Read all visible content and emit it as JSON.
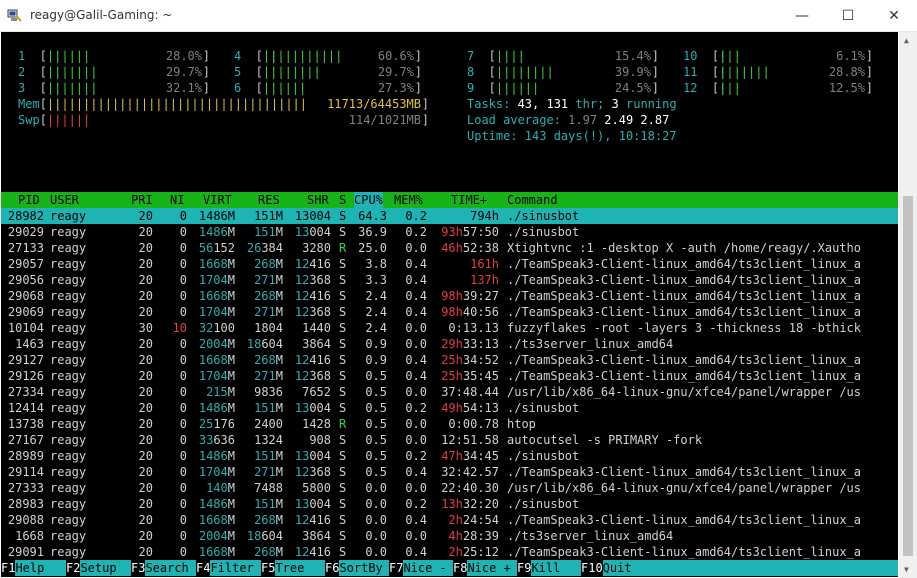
{
  "window": {
    "title": "reagy@Galil-Gaming: ~"
  },
  "meters": {
    "cpus": [
      {
        "label": "1",
        "bar": "||||||",
        "pct": "28.0%"
      },
      {
        "label": "2",
        "bar": "|||||||",
        "pct": "29.7%"
      },
      {
        "label": "3",
        "bar": "|||||||",
        "pct": "32.1%"
      },
      {
        "label": "4",
        "bar": "|||||||||||",
        "pct": "60.6%"
      },
      {
        "label": "5",
        "bar": "||||||||",
        "pct": "29.7%"
      },
      {
        "label": "6",
        "bar": "||||||",
        "pct": "27.3%"
      },
      {
        "label": "7",
        "bar": "||||",
        "pct": "15.4%"
      },
      {
        "label": "8",
        "bar": "||||||||",
        "pct": "39.9%"
      },
      {
        "label": "9",
        "bar": "||||||",
        "pct": "24.5%"
      },
      {
        "label": "10",
        "bar": "|||",
        "pct": "6.1%"
      },
      {
        "label": "11",
        "bar": "|||||||",
        "pct": "28.8%"
      },
      {
        "label": "12",
        "bar": "|||",
        "pct": "12.5%"
      }
    ],
    "mem": {
      "label": "Mem",
      "bar": "||||||||||||||||||||||||||||||||||||",
      "value": "11713/64453MB"
    },
    "swp": {
      "label": "Swp",
      "bar": "||||||",
      "value": "114/1021MB"
    },
    "tasks": {
      "label": "Tasks:",
      "count": "43,",
      "thr": "131",
      "thr_label": "thr;",
      "running": "3",
      "running_label": "running"
    },
    "load": {
      "label": "Load average:",
      "v1": "1.97",
      "v2": "2.49",
      "v3": "2.87"
    },
    "uptime": {
      "label": "Uptime:",
      "value": "143 days(!), 10:18:27"
    }
  },
  "table": {
    "headers": [
      "PID",
      "USER",
      "PRI",
      "NI",
      "VIRT",
      "RES",
      "SHR",
      "S",
      "CPU%",
      "MEM%",
      "TIME+",
      "Command"
    ],
    "rows": [
      {
        "pid": "28982",
        "user": "reagy",
        "pri": "20",
        "ni": "0",
        "virt": "1486M",
        "res": "151M",
        "shr": "13004",
        "s": "S",
        "cpu": "64.3",
        "mem": "0.2",
        "time": "794h",
        "cmd": "./sinusbot"
      },
      {
        "pid": "29029",
        "user": "reagy",
        "pri": "20",
        "ni": "0",
        "virt": "1486M",
        "res": "151M",
        "shr": "13004",
        "s": "S",
        "cpu": "36.9",
        "mem": "0.2",
        "time": "93h57:50",
        "cmd": "./sinusbot"
      },
      {
        "pid": "27133",
        "user": "reagy",
        "pri": "20",
        "ni": "0",
        "virt": "56152",
        "res": "26384",
        "shr": "3280",
        "s": "R",
        "cpu": "25.0",
        "mem": "0.0",
        "time": "46h52:38",
        "cmd": "Xtightvnc :1 -desktop X -auth /home/reagy/.Xautho"
      },
      {
        "pid": "29057",
        "user": "reagy",
        "pri": "20",
        "ni": "0",
        "virt": "1668M",
        "res": "268M",
        "shr": "12416",
        "s": "S",
        "cpu": "3.8",
        "mem": "0.4",
        "time": "161h",
        "cmd": "./TeamSpeak3-Client-linux_amd64/ts3client_linux_a"
      },
      {
        "pid": "29056",
        "user": "reagy",
        "pri": "20",
        "ni": "0",
        "virt": "1704M",
        "res": "271M",
        "shr": "12368",
        "s": "S",
        "cpu": "3.3",
        "mem": "0.4",
        "time": "137h",
        "cmd": "./TeamSpeak3-Client-linux_amd64/ts3client_linux_a"
      },
      {
        "pid": "29068",
        "user": "reagy",
        "pri": "20",
        "ni": "0",
        "virt": "1668M",
        "res": "268M",
        "shr": "12416",
        "s": "S",
        "cpu": "2.4",
        "mem": "0.4",
        "time": "98h39:27",
        "cmd": "./TeamSpeak3-Client-linux_amd64/ts3client_linux_a"
      },
      {
        "pid": "29069",
        "user": "reagy",
        "pri": "20",
        "ni": "0",
        "virt": "1704M",
        "res": "271M",
        "shr": "12368",
        "s": "S",
        "cpu": "2.4",
        "mem": "0.4",
        "time": "98h40:56",
        "cmd": "./TeamSpeak3-Client-linux_amd64/ts3client_linux_a"
      },
      {
        "pid": "10104",
        "user": "reagy",
        "pri": "30",
        "ni": "10",
        "virt": "32100",
        "res": "1804",
        "shr": "1440",
        "s": "S",
        "cpu": "2.4",
        "mem": "0.0",
        "time": "0:13.13",
        "cmd": "fuzzyflakes -root -layers 3 -thickness 18 -bthick"
      },
      {
        "pid": "1463",
        "user": "reagy",
        "pri": "20",
        "ni": "0",
        "virt": "2004M",
        "res": "18604",
        "shr": "3864",
        "s": "S",
        "cpu": "0.9",
        "mem": "0.0",
        "time": "29h33:13",
        "cmd": "./ts3server_linux_amd64"
      },
      {
        "pid": "29127",
        "user": "reagy",
        "pri": "20",
        "ni": "0",
        "virt": "1668M",
        "res": "268M",
        "shr": "12416",
        "s": "S",
        "cpu": "0.9",
        "mem": "0.4",
        "time": "25h34:52",
        "cmd": "./TeamSpeak3-Client-linux_amd64/ts3client_linux_a"
      },
      {
        "pid": "29126",
        "user": "reagy",
        "pri": "20",
        "ni": "0",
        "virt": "1704M",
        "res": "271M",
        "shr": "12368",
        "s": "S",
        "cpu": "0.5",
        "mem": "0.4",
        "time": "25h35:45",
        "cmd": "./TeamSpeak3-Client-linux_amd64/ts3client_linux_a"
      },
      {
        "pid": "27334",
        "user": "reagy",
        "pri": "20",
        "ni": "0",
        "virt": "215M",
        "res": "9836",
        "shr": "7652",
        "s": "S",
        "cpu": "0.5",
        "mem": "0.0",
        "time": "37:48.44",
        "cmd": "/usr/lib/x86_64-linux-gnu/xfce4/panel/wrapper /us"
      },
      {
        "pid": "12414",
        "user": "reagy",
        "pri": "20",
        "ni": "0",
        "virt": "1486M",
        "res": "151M",
        "shr": "13004",
        "s": "S",
        "cpu": "0.5",
        "mem": "0.2",
        "time": "49h54:13",
        "cmd": "./sinusbot"
      },
      {
        "pid": "13738",
        "user": "reagy",
        "pri": "20",
        "ni": "0",
        "virt": "25176",
        "res": "2400",
        "shr": "1428",
        "s": "R",
        "cpu": "0.5",
        "mem": "0.0",
        "time": "0:00.78",
        "cmd": "htop"
      },
      {
        "pid": "27167",
        "user": "reagy",
        "pri": "20",
        "ni": "0",
        "virt": "33636",
        "res": "1324",
        "shr": "908",
        "s": "S",
        "cpu": "0.5",
        "mem": "0.0",
        "time": "12:51.58",
        "cmd": "autocutsel -s PRIMARY -fork"
      },
      {
        "pid": "28989",
        "user": "reagy",
        "pri": "20",
        "ni": "0",
        "virt": "1486M",
        "res": "151M",
        "shr": "13004",
        "s": "S",
        "cpu": "0.5",
        "mem": "0.2",
        "time": "47h34:45",
        "cmd": "./sinusbot"
      },
      {
        "pid": "29114",
        "user": "reagy",
        "pri": "20",
        "ni": "0",
        "virt": "1704M",
        "res": "271M",
        "shr": "12368",
        "s": "S",
        "cpu": "0.5",
        "mem": "0.4",
        "time": "32:42.57",
        "cmd": "./TeamSpeak3-Client-linux_amd64/ts3client_linux_a"
      },
      {
        "pid": "27333",
        "user": "reagy",
        "pri": "20",
        "ni": "0",
        "virt": "140M",
        "res": "7488",
        "shr": "5800",
        "s": "S",
        "cpu": "0.0",
        "mem": "0.0",
        "time": "22:40.30",
        "cmd": "/usr/lib/x86_64-linux-gnu/xfce4/panel/wrapper /us"
      },
      {
        "pid": "28983",
        "user": "reagy",
        "pri": "20",
        "ni": "0",
        "virt": "1486M",
        "res": "151M",
        "shr": "13004",
        "s": "S",
        "cpu": "0.0",
        "mem": "0.2",
        "time": "13h32:20",
        "cmd": "./sinusbot"
      },
      {
        "pid": "29088",
        "user": "reagy",
        "pri": "20",
        "ni": "0",
        "virt": "1668M",
        "res": "268M",
        "shr": "12416",
        "s": "S",
        "cpu": "0.0",
        "mem": "0.4",
        "time": "2h24:54",
        "cmd": "./TeamSpeak3-Client-linux_amd64/ts3client_linux_a"
      },
      {
        "pid": "1668",
        "user": "reagy",
        "pri": "20",
        "ni": "0",
        "virt": "2004M",
        "res": "18604",
        "shr": "3864",
        "s": "S",
        "cpu": "0.0",
        "mem": "0.0",
        "time": "4h28:39",
        "cmd": "./ts3server_linux_amd64"
      },
      {
        "pid": "29091",
        "user": "reagy",
        "pri": "20",
        "ni": "0",
        "virt": "1668M",
        "res": "268M",
        "shr": "12416",
        "s": "S",
        "cpu": "0.0",
        "mem": "0.4",
        "time": "2h25:12",
        "cmd": "./TeamSpeak3-Client-linux_amd64/ts3client_linux_a"
      },
      {
        "pid": "29100",
        "user": "reagy",
        "pri": "20",
        "ni": "0",
        "virt": "1668M",
        "res": "268M",
        "shr": "12416",
        "s": "S",
        "cpu": "0.0",
        "mem": "0.4",
        "time": "2h24:58",
        "cmd": "./TeamSpeak3-Client-linux_amd64/ts3client_linux_a"
      },
      {
        "pid": "1666",
        "user": "reagy",
        "pri": "20",
        "ni": "0",
        "virt": "2004M",
        "res": "18604",
        "shr": "3864",
        "s": "S",
        "cpu": "0.0",
        "mem": "0.0",
        "time": "4h28:39",
        "cmd": "./ts3server_linux_amd64"
      }
    ]
  },
  "footer": [
    {
      "key": "F1",
      "label": "Help"
    },
    {
      "key": "F2",
      "label": "Setup"
    },
    {
      "key": "F3",
      "label": "Search"
    },
    {
      "key": "F4",
      "label": "Filter"
    },
    {
      "key": "F5",
      "label": "Tree"
    },
    {
      "key": "F6",
      "label": "SortBy"
    },
    {
      "key": "F7",
      "label": "Nice -"
    },
    {
      "key": "F8",
      "label": "Nice +"
    },
    {
      "key": "F9",
      "label": "Kill"
    },
    {
      "key": "F10",
      "label": "Quit"
    }
  ],
  "icons": {
    "app": "putty-icon",
    "minimize": "minimize-icon",
    "maximize": "maximize-icon",
    "close": "close-icon"
  }
}
